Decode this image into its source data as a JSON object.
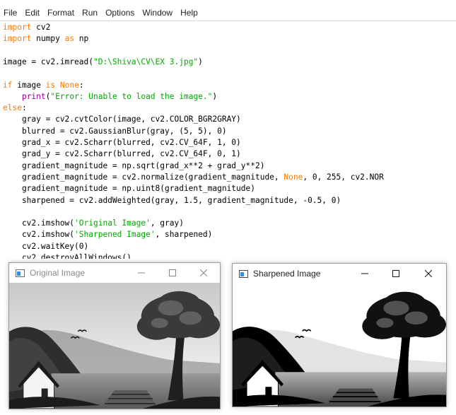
{
  "menu": [
    "File",
    "Edit",
    "Format",
    "Run",
    "Options",
    "Window",
    "Help"
  ],
  "code": {
    "l1": [
      "import",
      " cv2"
    ],
    "l2": [
      "import",
      " numpy ",
      "as",
      " np"
    ],
    "l4": [
      "image = cv2.imread(",
      "\"D:\\Shiva\\CV\\EX 3.jpg\"",
      ")"
    ],
    "l6": [
      "if",
      " image ",
      "is",
      " ",
      "None",
      ":"
    ],
    "l7": [
      "    ",
      "print",
      "(",
      "\"Error: Unable to load the image.\"",
      ")"
    ],
    "l8": [
      "else",
      ":"
    ],
    "l9": "    gray = cv2.cvtColor(image, cv2.COLOR_BGR2GRAY)",
    "l10": "    blurred = cv2.GaussianBlur(gray, (5, 5), 0)",
    "l11": "    grad_x = cv2.Scharr(blurred, cv2.CV_64F, 1, 0)",
    "l12": "    grad_y = cv2.Scharr(blurred, cv2.CV_64F, 0, 1)",
    "l13": "    gradient_magnitude = np.sqrt(grad_x**2 + grad_y**2)",
    "l14": [
      "    gradient_magnitude = cv2.normalize(gradient_magnitude, ",
      "None",
      ", 0, 255, cv2.NOR"
    ],
    "l15": "    gradient_magnitude = np.uint8(gradient_magnitude)",
    "l16": "    sharpened = cv2.addWeighted(gray, 1.5, gradient_magnitude, -0.5, 0)",
    "l18": [
      "    cv2.imshow(",
      "'Original Image'",
      ", gray)"
    ],
    "l19": [
      "    cv2.imshow(",
      "'Sharpened Image'",
      ", sharpened)"
    ],
    "l20": "    cv2.waitKey(0)",
    "l21": "    cv2.destroyAllWindows()"
  },
  "windows": {
    "original": {
      "title": "Original Image",
      "active": false
    },
    "sharpened": {
      "title": "Sharpened Image",
      "active": true
    }
  },
  "colors": {
    "keyword": "#ff7700",
    "builtin": "#900090",
    "string": "#00aa00"
  },
  "icons": [
    "window-icon",
    "minimize-icon",
    "maximize-icon",
    "close-icon"
  ]
}
